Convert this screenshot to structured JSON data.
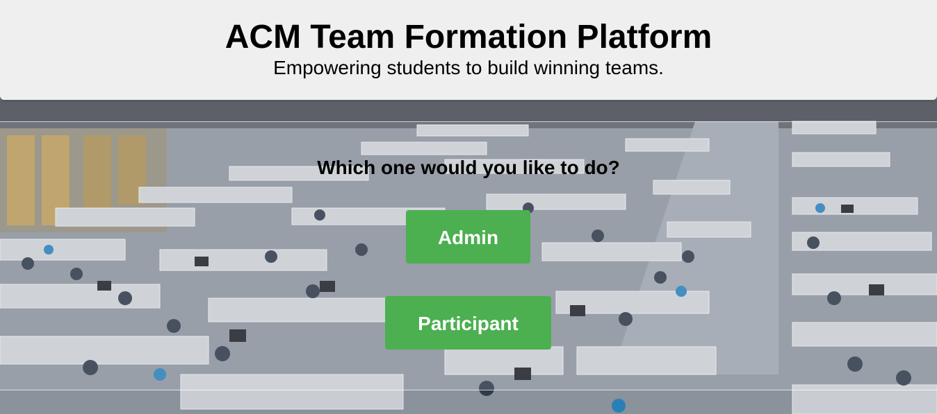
{
  "header": {
    "title": "ACM Team Formation Platform",
    "subtitle": "Empowering students to build winning teams."
  },
  "main": {
    "question": "Which one would you like to do?",
    "buttons": {
      "admin_label": "Admin",
      "participant_label": "Participant"
    }
  },
  "colors": {
    "button_bg": "#4caf50",
    "header_bg": "#efefef"
  }
}
